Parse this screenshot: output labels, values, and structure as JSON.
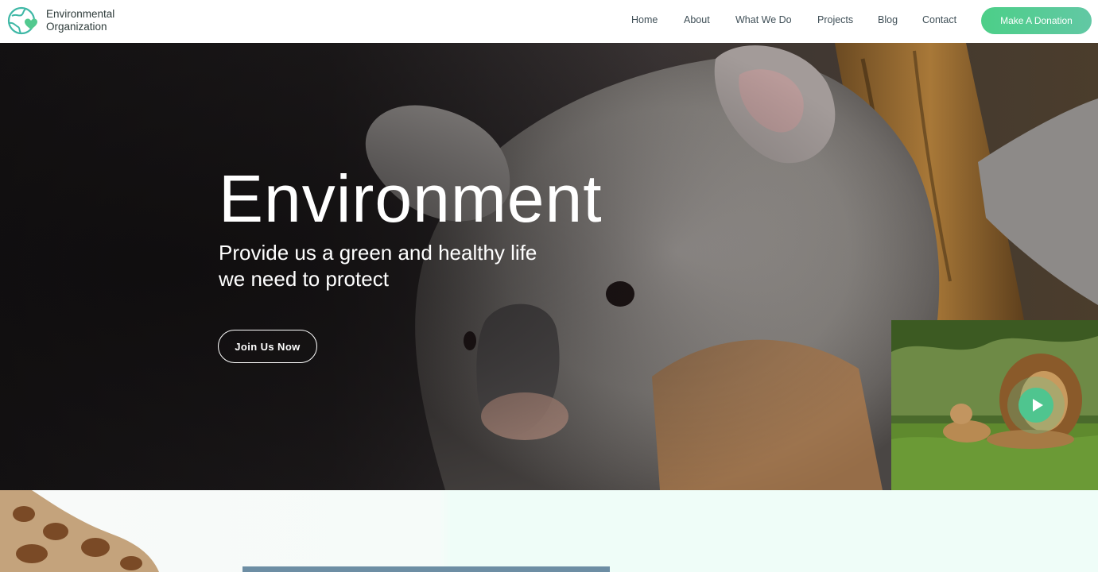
{
  "header": {
    "brand_line1": "Environmental",
    "brand_line2": "Organization",
    "nav": [
      {
        "label": "Home"
      },
      {
        "label": "About"
      },
      {
        "label": "What We Do"
      },
      {
        "label": "Projects"
      },
      {
        "label": "Blog"
      },
      {
        "label": "Contact"
      }
    ],
    "donate_label": "Make A Donation"
  },
  "hero": {
    "title": "Environment",
    "subtitle_line1": "Provide us a green and healthy life",
    "subtitle_line2": "we need to protect",
    "cta_label": "Join Us Now",
    "video_play_icon": "play-icon"
  },
  "icons": {
    "logo": "globe-heart-logo-icon"
  },
  "colors": {
    "accent": "#4ccf88",
    "nav_text": "#3f4f57",
    "hero_text": "#ffffff"
  }
}
